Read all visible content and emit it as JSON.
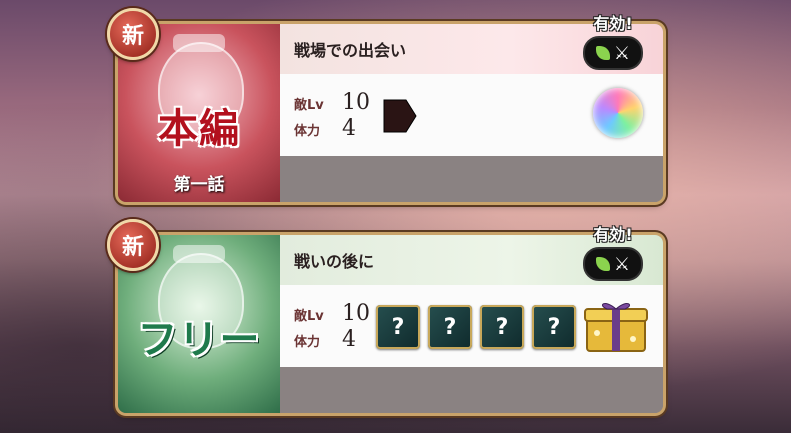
{
  "quests": [
    {
      "badge": "新",
      "effective_label": "有効!",
      "category": "本編",
      "episode": "第一話",
      "title": "戦場での出会い",
      "enemy_level_label": "敵Lv",
      "enemy_level": "10",
      "stamina_label": "体力",
      "stamina": "4",
      "reward_icon": "rainbow-gem-icon"
    },
    {
      "badge": "新",
      "effective_label": "有効!",
      "category": "フリー",
      "title": "戦いの後に",
      "enemy_level_label": "敵Lv",
      "enemy_level": "10",
      "stamina_label": "体力",
      "stamina": "4",
      "unknown_drops": [
        "?",
        "?",
        "?",
        "?"
      ],
      "reward_icon": "gold-gift-box-icon"
    }
  ],
  "colors": {
    "story_accent": "#b3111e",
    "free_accent": "#1f7a4c",
    "frame": "#c9a36a"
  }
}
